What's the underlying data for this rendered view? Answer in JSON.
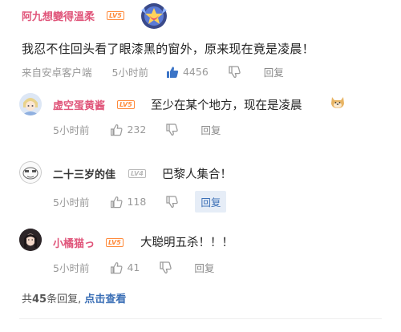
{
  "top_comment": {
    "username": "阿九想變得溫柔",
    "level_badge": "LV5",
    "text": "我忍不住回头看了眼漆黑的窗外，原来现在竟是凌晨！",
    "source": "来自安卓客户端",
    "time": "5小时前",
    "likes": "4456",
    "reply_label": "回复"
  },
  "replies": [
    {
      "username": "虚空蛋黄酱",
      "level_badge": "LV5",
      "text": "至少在某个地方，现在是凌晨",
      "time": "5小时前",
      "likes": "232",
      "reply_label": "回复"
    },
    {
      "username": "二十三岁的佳",
      "level_badge": "LV4",
      "text": "巴黎人集合！",
      "time": "5小时前",
      "likes": "118",
      "reply_label": "回复"
    },
    {
      "username": "小橘猫っ",
      "level_badge": "LV5",
      "text": "大聪明五杀！！！",
      "time": "5小时前",
      "likes": "41",
      "reply_label": "回复"
    }
  ],
  "summary": {
    "count_prefix": "共",
    "count": "45",
    "count_suffix": "条回复, ",
    "link": "点击查看"
  },
  "colors": {
    "username_pink": "#e0557a",
    "like_active_blue": "#3b74c7",
    "link_blue": "#3b6fb6"
  }
}
